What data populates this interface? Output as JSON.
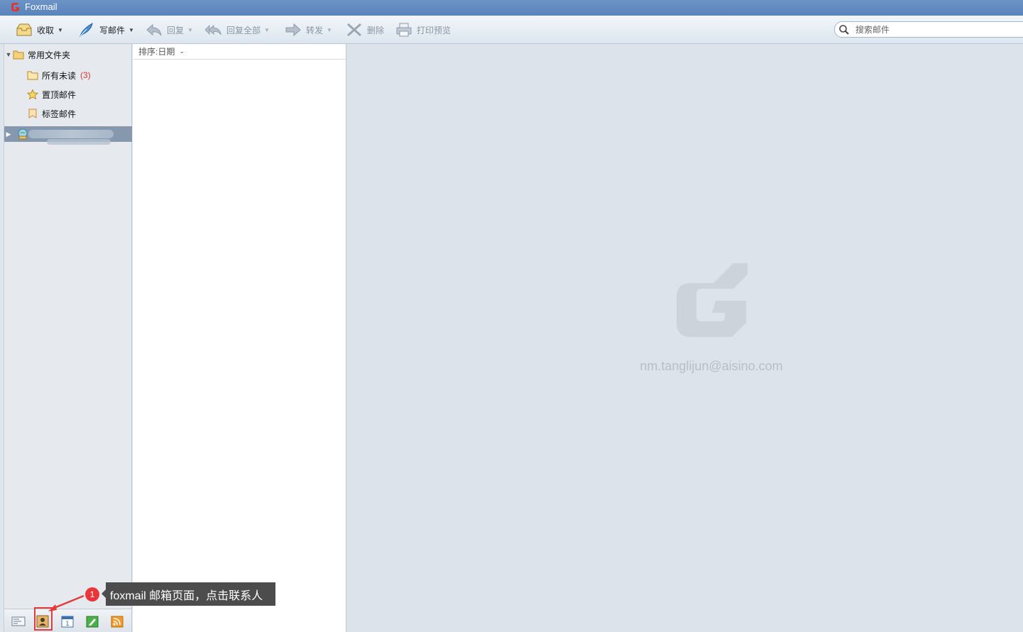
{
  "window": {
    "title": "Foxmail"
  },
  "toolbar": {
    "receive_label": "收取",
    "compose_label": "写邮件",
    "reply_label": "回复",
    "reply_all_label": "回复全部",
    "forward_label": "转发",
    "delete_label": "删除",
    "print_preview_label": "打印预览"
  },
  "search": {
    "placeholder": "搜索邮件"
  },
  "sidebar": {
    "group_label": "常用文件夹",
    "items": [
      {
        "label": "所有未读",
        "count": "(3)"
      },
      {
        "label": "置顶邮件"
      },
      {
        "label": "标签邮件"
      }
    ]
  },
  "maillist": {
    "sort_label": "排序:日期"
  },
  "reading": {
    "email": "nm.tanglijun@aisino.com"
  },
  "annotation": {
    "step": "1",
    "text": "foxmail 邮箱页面，点击联系人"
  },
  "colors": {
    "accent": "#5a83bb",
    "highlight": "#e23b3b",
    "unread": "#dd3333"
  }
}
